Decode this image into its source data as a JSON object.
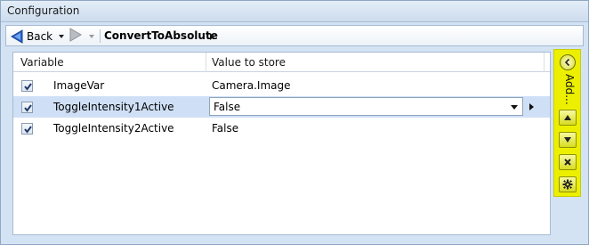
{
  "window": {
    "title": "Configuration"
  },
  "toolbar": {
    "back_label": "Back",
    "breadcrumb": "ConvertToAbsolute"
  },
  "grid": {
    "columns": [
      "Variable",
      "Value to store"
    ],
    "rows": [
      {
        "checked": true,
        "variable": "ImageVar",
        "value": "Camera.Image",
        "selected": false
      },
      {
        "checked": true,
        "variable": "ToggleIntensity1Active",
        "value": "False",
        "selected": true
      },
      {
        "checked": true,
        "variable": "ToggleIntensity2Active",
        "value": "False",
        "selected": false
      }
    ]
  },
  "sidepanel": {
    "label": "Add...",
    "icons": [
      "collapse-left-icon",
      "move-up-icon",
      "move-down-icon",
      "delete-icon",
      "settings-gear-icon"
    ]
  },
  "colors": {
    "accent_panel": "#ecf000",
    "selection": "#cfe0f6"
  }
}
